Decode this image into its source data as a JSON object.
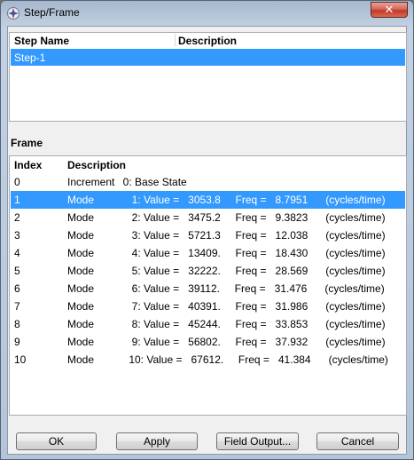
{
  "window": {
    "title": "Step/Frame",
    "close_label": "✕"
  },
  "step_table": {
    "headers": {
      "name": "Step Name",
      "description": "Description"
    },
    "rows": [
      {
        "name": "Step-1",
        "description": "",
        "selected": true
      }
    ]
  },
  "frame_section": {
    "label": "Frame",
    "headers": {
      "index": "Index",
      "description": "Description"
    },
    "rows": [
      {
        "index": "0",
        "type": "Increment",
        "detail": "  0: Base State",
        "selected": false
      },
      {
        "index": "1",
        "type": "Mode",
        "detail": "     1: Value =   3053.8     Freq =   8.7951      (cycles/time)",
        "selected": true
      },
      {
        "index": "2",
        "type": "Mode",
        "detail": "     2: Value =   3475.2     Freq =   9.3823      (cycles/time)",
        "selected": false
      },
      {
        "index": "3",
        "type": "Mode",
        "detail": "     3: Value =   5721.3     Freq =   12.038      (cycles/time)",
        "selected": false
      },
      {
        "index": "4",
        "type": "Mode",
        "detail": "     4: Value =   13409.     Freq =   18.430      (cycles/time)",
        "selected": false
      },
      {
        "index": "5",
        "type": "Mode",
        "detail": "     5: Value =   32222.     Freq =   28.569      (cycles/time)",
        "selected": false
      },
      {
        "index": "6",
        "type": "Mode",
        "detail": "     6: Value =   39112.     Freq =   31.476      (cycles/time)",
        "selected": false
      },
      {
        "index": "7",
        "type": "Mode",
        "detail": "     7: Value =   40391.     Freq =   31.986      (cycles/time)",
        "selected": false
      },
      {
        "index": "8",
        "type": "Mode",
        "detail": "     8: Value =   45244.     Freq =   33.853      (cycles/time)",
        "selected": false
      },
      {
        "index": "9",
        "type": "Mode",
        "detail": "     9: Value =   56802.     Freq =   37.932      (cycles/time)",
        "selected": false
      },
      {
        "index": "10",
        "type": "Mode",
        "detail": "    10: Value =   67612.     Freq =   41.384      (cycles/time)",
        "selected": false
      }
    ]
  },
  "buttons": {
    "ok": "OK",
    "apply": "Apply",
    "field_output": "Field Output...",
    "cancel": "Cancel"
  },
  "colors": {
    "selection": "#3399ff",
    "client_bg": "#f0f0f0"
  }
}
